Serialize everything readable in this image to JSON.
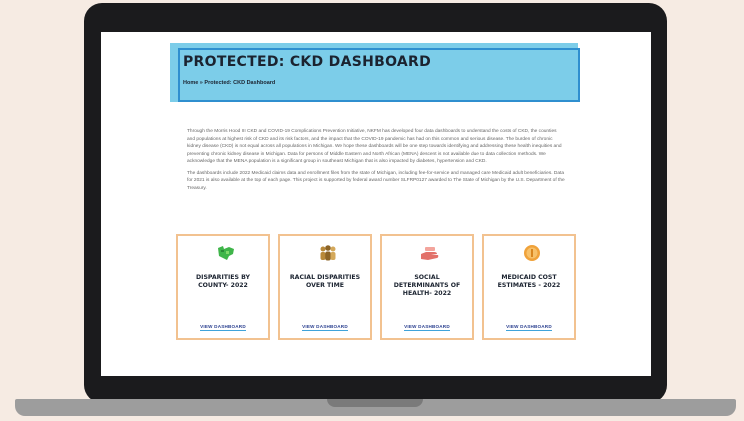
{
  "page": {
    "title": "PROTECTED: CKD DASHBOARD",
    "breadcrumb": "Home » Protected: CKD Dashboard"
  },
  "intro": {
    "paragraph1": "Through the Morris Hood III CKD and COVID-19 Complications Prevention Initiative, NKFM has developed four data dashboards to understand the costs of CKD, the counties and populations at highest risk of CKD and its risk factors, and the impact that the COVID-19 pandemic has had on this common and serious disease. The burden of chronic kidney disease (CKD) is not equal across all populations in Michigan. We hope these dashboards will be one step towards identifying and addressing these health inequities and preventing chronic kidney disease in Michigan. Data for persons of Middle Eastern and North African (MENA) descent is not available due to data collection methods. We acknowledge that the MENA population is a significant group in southeast Michigan that is also impacted by diabetes, hypertension and CKD.",
    "paragraph2": "The dashboards include 2022 Medicaid claims data and enrollment files from the state of Michigan, including fee-for-service and managed care Medicaid adult beneficiaries. Data for 2021 is also available at the top of each page. This project is supported by federal award number SLFRP0127 awarded to The State of Michigan by the U.S. Department of the Treasury."
  },
  "cards": [
    {
      "title": "DISPARITIES BY COUNTY- 2022",
      "link": "VIEW DASHBOARD",
      "icon": "map-icon",
      "color": "#3fb54a"
    },
    {
      "title": "RACIAL DISPARITIES OVER TIME",
      "link": "VIEW DASHBOARD",
      "icon": "people-icon",
      "color": "#b8893a"
    },
    {
      "title": "SOCIAL DETERMINANTS OF HEALTH- 2022",
      "link": "VIEW DASHBOARD",
      "icon": "hand-icon",
      "color": "#e2716a"
    },
    {
      "title": "MEDICAID COST ESTIMATES - 2022",
      "link": "VIEW DASHBOARD",
      "icon": "coin-icon",
      "color": "#f0a23a"
    }
  ]
}
